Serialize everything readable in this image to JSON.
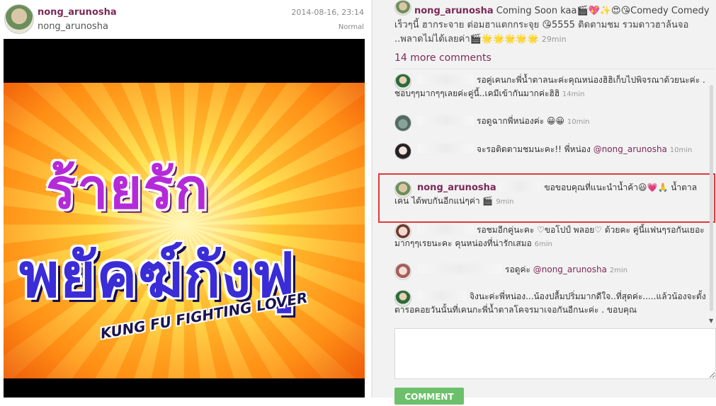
{
  "post": {
    "username": "nong_arunosha",
    "subname": "nong_arunosha",
    "date": "2014-08-16, 23:14",
    "filter": "Normal",
    "poster_title_line1": "ร้ายรัก",
    "poster_title_line2": "พยัคฆ์กังฟู",
    "poster_subtitle": "KUNG FU FIGHTING LOVER"
  },
  "caption": {
    "username": "nong_arunosha",
    "text": "Coming Soon kaa🎬💖✨😍😘Comedy Comedy เร็วๆนี้ ฮากระจาย ต่อมฮาแตกกระจุย 😘5555 ติดตามชม รวมดาวฮาล้นจอ ..พลาดไม่ได้เลยค่า🎬🌟🌟🌟🌟🌟",
    "time": "29min"
  },
  "more_comments": "14 more comments",
  "comments": [
    {
      "text": "รอคู่เคนกะพี่น้ำตาลนะค่ะคุณหน่องฮิฮิเก็บไปพิจรณาด้วยนะค่ะ . ชอบๆๆมากๆๆเลยค่ะคู่นี้..เคมีเข้ากันมากค่ะฮิฮิ",
      "time": "14min"
    },
    {
      "text": "รอดูฉากพี่หน่องค่ะ 😀😀",
      "time": "10min"
    },
    {
      "text": "จะรอติดตามชมนะคะ!! พี่หน่อง",
      "mention": "@nong_arunosha",
      "time": "10min"
    },
    {
      "owner": "nong_arunosha",
      "text": "ขอขอบคุณที่แนะนำน้ำค้า😃💗🙏 น้ำตาล เคน ได้พบกันอีกแน่ๆค่า 🎬",
      "time": "9min"
    },
    {
      "text": "รอชมอีกคู่นะคะ ♡ขอโปป์ พลอย♡ ด้วยคะ คู่นี้แฟนๆรอกันเยอะมากๆๆเรยนะคะ คุนหน่องที่น่ารักเสมอ",
      "time": "6min"
    },
    {
      "text": "รอดูค่ะ",
      "mention": "@nong_arunosha",
      "time": "2min"
    },
    {
      "text": "จิงนะค่ะพี่หน่อง...น้องปลื้มปริ่มมากดีใจ..ที่สุดค่ะ.....แล้วน้องจะตั้งตารอคอยวันนั้นที่เคนกะพี่น้ำตาลโคจรมาเจอกันอีกนะค่ะ . ขอบคุณ"
    }
  ],
  "comment_box": {
    "placeholder": ""
  },
  "comment_button": "COMMENT"
}
